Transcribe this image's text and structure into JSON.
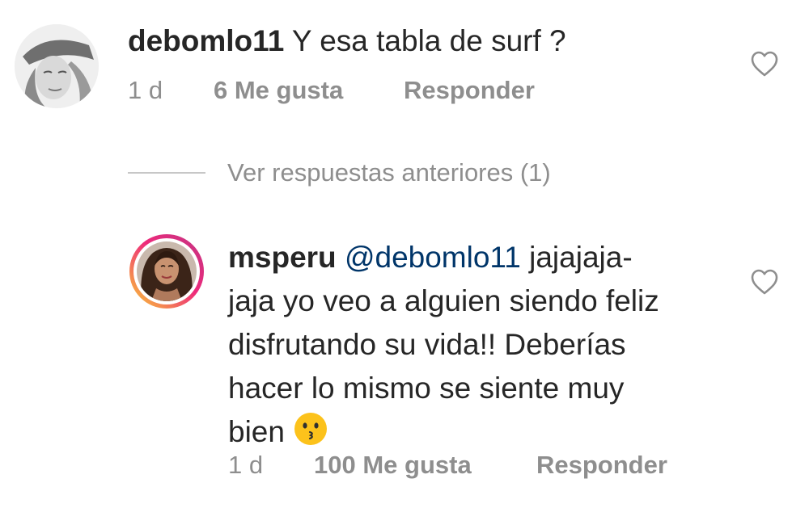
{
  "comments": [
    {
      "username": "debomlo11",
      "text": "Y esa tabla de surf ?",
      "time": "1 d",
      "likes": "6 Me gusta",
      "reply": "Responder"
    },
    {
      "username": "msperu",
      "mention": "@debomlo11",
      "text_line1": "jajajaja-",
      "text_line2": "jaja yo veo a alguien siendo feliz",
      "text_line3": "disfrutando su vida!! Deberías",
      "text_line4": "hacer lo mismo se siente muy",
      "text_line5": "bien",
      "emoji": "kissing-face-emoji",
      "time": "1 d",
      "likes": "100 Me gusta",
      "reply": "Responder"
    }
  ],
  "view_replies": "Ver respuestas anteriores (1)",
  "colors": {
    "text": "#262626",
    "meta": "#8e8e8e",
    "mention": "#003569",
    "divider": "#c7c7c7"
  },
  "icons": {
    "like": "heart-outline-icon",
    "avatar1": "user-avatar-photo",
    "avatar2": "user-avatar-story-ring"
  }
}
